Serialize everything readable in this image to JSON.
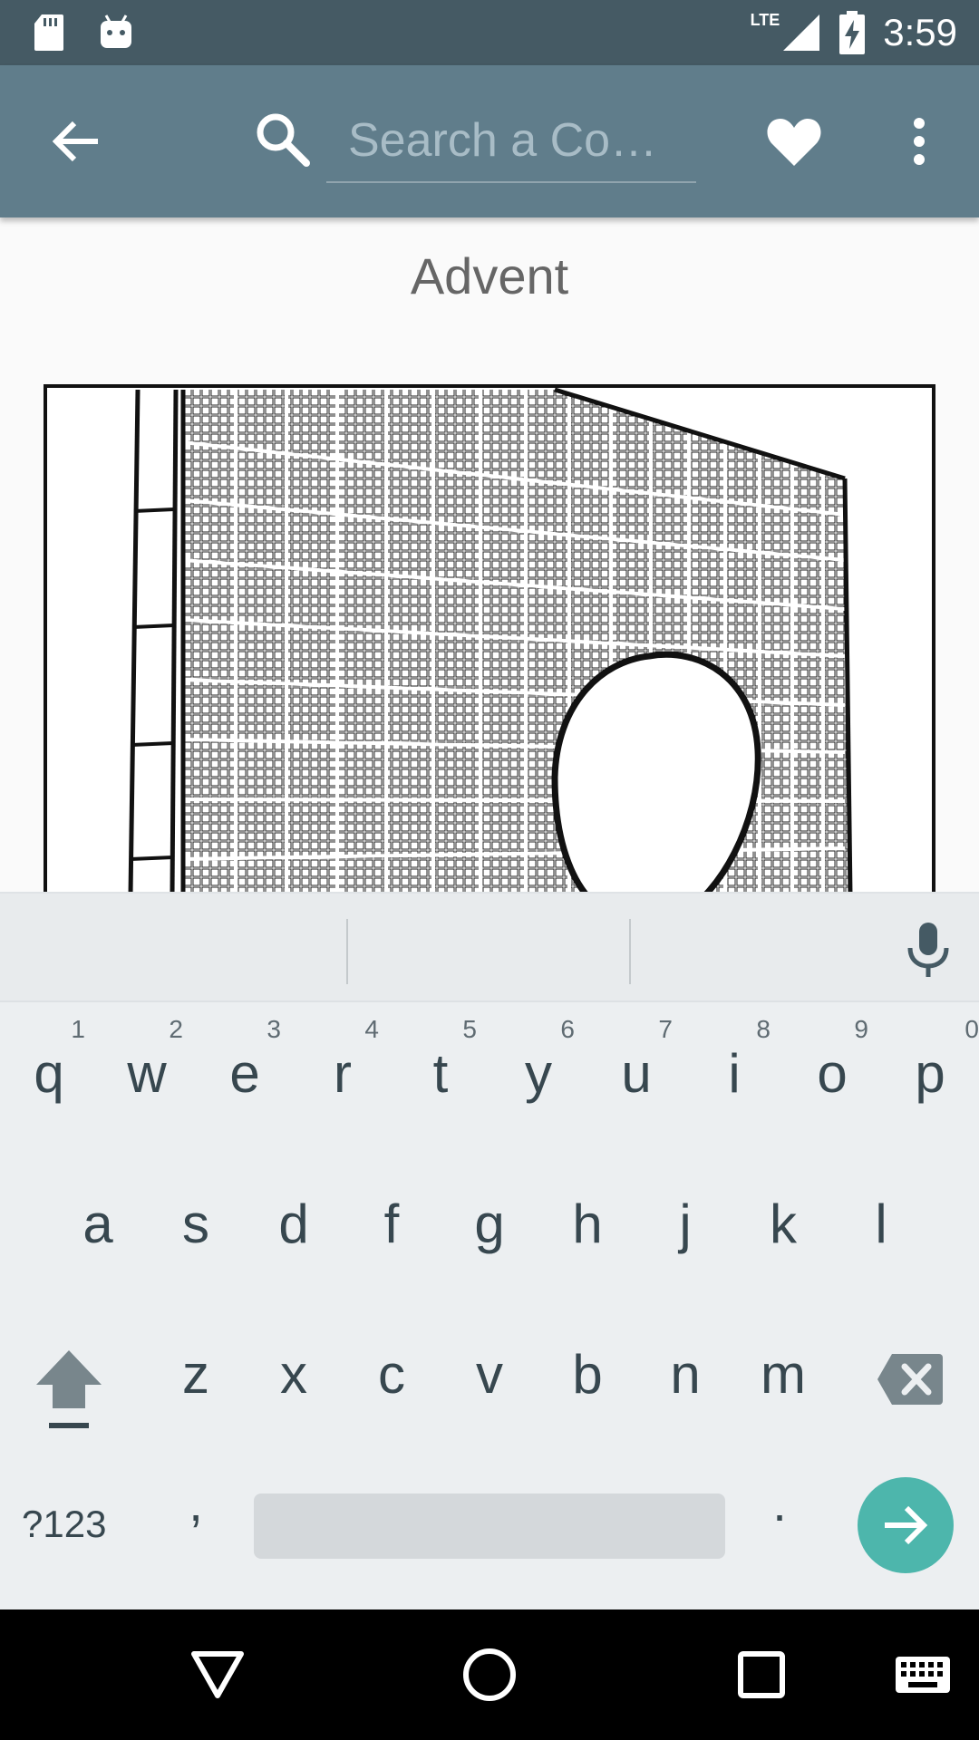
{
  "status_bar": {
    "network": "LTE",
    "time": "3:59",
    "icons": [
      "sd-card-icon",
      "android-icon",
      "signal-icon",
      "battery-charging-icon"
    ]
  },
  "app_bar": {
    "search_placeholder": "Search a Co…",
    "icons": [
      "back-arrow-icon",
      "search-icon",
      "heart-icon",
      "more-vert-icon"
    ]
  },
  "content": {
    "title": "Advent"
  },
  "keyboard": {
    "row1": [
      {
        "key": "q",
        "hint": "1"
      },
      {
        "key": "w",
        "hint": "2"
      },
      {
        "key": "e",
        "hint": "3"
      },
      {
        "key": "r",
        "hint": "4"
      },
      {
        "key": "t",
        "hint": "5"
      },
      {
        "key": "y",
        "hint": "6"
      },
      {
        "key": "u",
        "hint": "7"
      },
      {
        "key": "i",
        "hint": "8"
      },
      {
        "key": "o",
        "hint": "9"
      },
      {
        "key": "p",
        "hint": "0"
      }
    ],
    "row2": [
      "a",
      "s",
      "d",
      "f",
      "g",
      "h",
      "j",
      "k",
      "l"
    ],
    "row3": [
      "z",
      "x",
      "c",
      "v",
      "b",
      "n",
      "m"
    ],
    "symbols_label": "?123",
    "comma": ",",
    "period": ".",
    "accent_color": "#4db6ac"
  },
  "nav_bar": {
    "icons": [
      "back-triangle-icon",
      "home-circle-icon",
      "recents-square-icon",
      "keyboard-icon"
    ]
  }
}
